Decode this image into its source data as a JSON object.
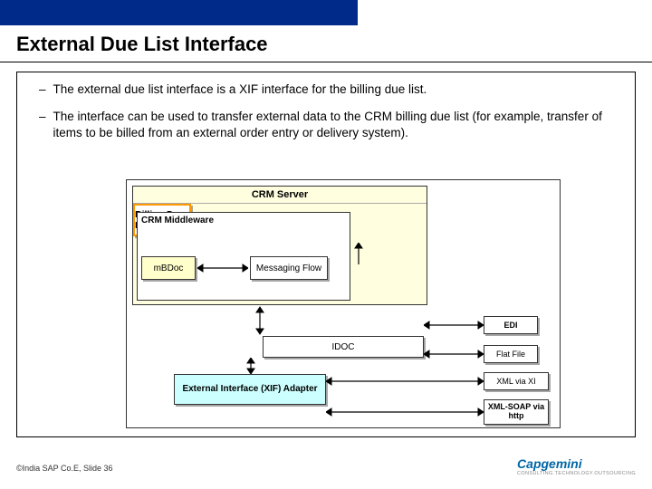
{
  "title": "External Due List Interface",
  "bullets": [
    "The external due list interface is a XIF interface for the billing due list.",
    "The interface can be used to transfer external data to the CRM billing due list (for example, transfer of items to be billed from an external order entry or delivery system)."
  ],
  "diagram": {
    "crm_server": "CRM Server",
    "crm_middleware": "CRM Middleware",
    "mbdoc": "mBDoc",
    "msgflow": "Messaging Flow",
    "bdl": "Billing Due List",
    "idoc": "IDOC",
    "xif": "External Interface (XIF) Adapter",
    "edi": "EDI",
    "flatfile": "Flat File",
    "xmlxi": "XML via XI",
    "xmlsoap": "XML-SOAP via http"
  },
  "footer": "©India SAP Co.E, Slide 36",
  "logo": {
    "name": "Capgemini",
    "tagline": "CONSULTING.TECHNOLOGY.OUTSOURCING"
  }
}
